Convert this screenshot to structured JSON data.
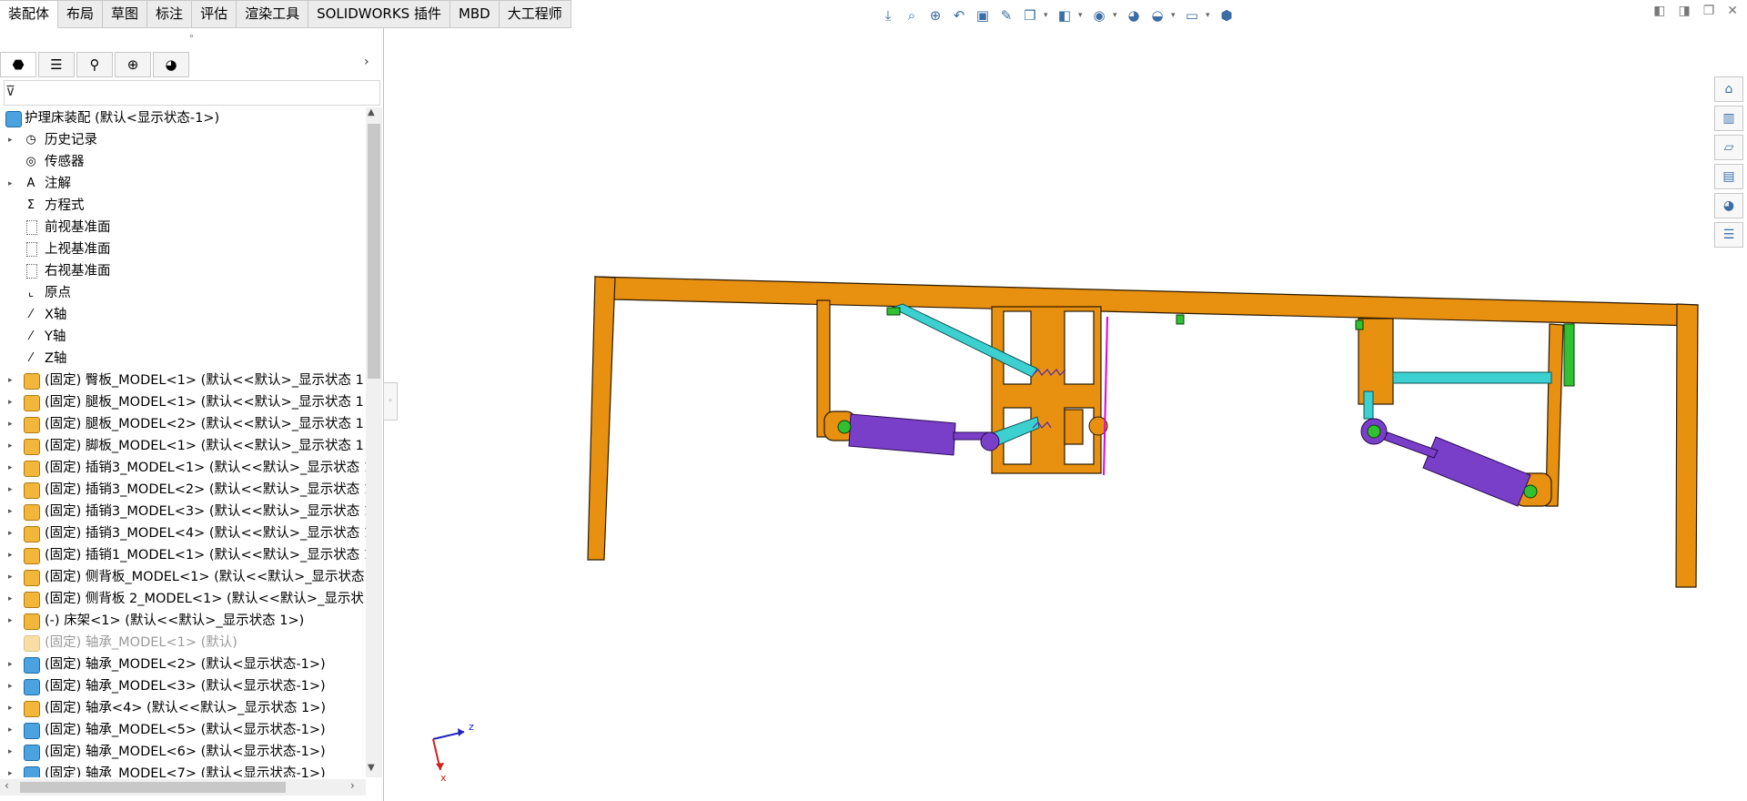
{
  "tabs": [
    {
      "label": "装配体",
      "active": true
    },
    {
      "label": "布局"
    },
    {
      "label": "草图"
    },
    {
      "label": "标注"
    },
    {
      "label": "评估"
    },
    {
      "label": "渲染工具"
    },
    {
      "label": "SOLIDWORKS 插件"
    },
    {
      "label": "MBD"
    },
    {
      "label": "大工程师"
    }
  ],
  "hud_icons": [
    "view-orient-icon",
    "zoom-fit-icon",
    "zoom-area-icon",
    "previous-view-icon",
    "section-view-icon",
    "dynamic-annotation-icon",
    "view-orientation-icon",
    "display-style-icon",
    "hide-show-icon",
    "edit-appearance-icon",
    "apply-scene-icon",
    "view-settings-icon",
    "3d-view-icon"
  ],
  "panel_tabs": [
    "featuremanager-icon",
    "propertymanager-icon",
    "configurationmanager-icon",
    "dimxpert-icon",
    "display-manager-icon"
  ],
  "tree": {
    "root": "护理床装配  (默认<显示状态-1>)",
    "items": [
      {
        "label": "历史记录",
        "icon": "history-icon",
        "expand": true
      },
      {
        "label": "传感器",
        "icon": "sensor-icon",
        "expand": false
      },
      {
        "label": "注解",
        "icon": "annotation-icon",
        "expand": true
      },
      {
        "label": "方程式",
        "icon": "equation-icon",
        "expand": false
      },
      {
        "label": "前视基准面",
        "icon": "plane-icon",
        "expand": false
      },
      {
        "label": "上视基准面",
        "icon": "plane-icon",
        "expand": false
      },
      {
        "label": "右视基准面",
        "icon": "plane-icon",
        "expand": false
      },
      {
        "label": "原点",
        "icon": "origin-icon",
        "expand": false
      },
      {
        "label": "X轴",
        "icon": "axis-icon",
        "expand": false
      },
      {
        "label": "Y轴",
        "icon": "axis-icon",
        "expand": false
      },
      {
        "label": "Z轴",
        "icon": "axis-icon",
        "expand": false
      },
      {
        "label": "(固定) 臀板_MODEL<1> (默认<<默认>_显示状态 1",
        "icon": "part-icon",
        "expand": true
      },
      {
        "label": "(固定) 腿板_MODEL<1> (默认<<默认>_显示状态 1",
        "icon": "part-icon",
        "expand": true
      },
      {
        "label": "(固定) 腿板_MODEL<2> (默认<<默认>_显示状态 1",
        "icon": "part-icon",
        "expand": true
      },
      {
        "label": "(固定) 脚板_MODEL<1> (默认<<默认>_显示状态 1",
        "icon": "part-icon",
        "expand": true
      },
      {
        "label": "(固定) 插销3_MODEL<1> (默认<<默认>_显示状态 1",
        "icon": "part-icon",
        "expand": true
      },
      {
        "label": "(固定) 插销3_MODEL<2> (默认<<默认>_显示状态 1",
        "icon": "part-icon",
        "expand": true
      },
      {
        "label": "(固定) 插销3_MODEL<3> (默认<<默认>_显示状态 1",
        "icon": "part-icon",
        "expand": true
      },
      {
        "label": "(固定) 插销3_MODEL<4> (默认<<默认>_显示状态 1",
        "icon": "part-icon",
        "expand": true
      },
      {
        "label": "(固定) 插销1_MODEL<1> (默认<<默认>_显示状态 1",
        "icon": "part-icon",
        "expand": true
      },
      {
        "label": "(固定) 侧背板_MODEL<1> (默认<<默认>_显示状态",
        "icon": "part-icon",
        "expand": true
      },
      {
        "label": "(固定) 侧背板 2_MODEL<1> (默认<<默认>_显示状",
        "icon": "part-icon",
        "expand": true
      },
      {
        "label": "(-) 床架<1> (默认<<默认>_显示状态 1>)",
        "icon": "part-icon",
        "expand": true
      },
      {
        "label": "(固定) 轴承_MODEL<1> (默认)",
        "icon": "part-icon",
        "expand": false,
        "dim": true
      },
      {
        "label": "(固定) 轴承_MODEL<2> (默认<显示状态-1>)",
        "icon": "part2-icon",
        "expand": true
      },
      {
        "label": "(固定) 轴承_MODEL<3> (默认<显示状态-1>)",
        "icon": "part2-icon",
        "expand": true
      },
      {
        "label": "(固定) 轴承<4> (默认<<默认>_显示状态 1>)",
        "icon": "part-icon",
        "expand": true
      },
      {
        "label": "(固定) 轴承_MODEL<5> (默认<显示状态-1>)",
        "icon": "part2-icon",
        "expand": true
      },
      {
        "label": "(固定) 轴承_MODEL<6> (默认<显示状态-1>)",
        "icon": "part2-icon",
        "expand": true
      },
      {
        "label": "(固定) 轴承_MODEL<7> (默认<显示状态-1>)",
        "icon": "part2-icon",
        "expand": true
      }
    ]
  },
  "task_pane": [
    "home-icon",
    "design-library-icon",
    "file-explorer-icon",
    "view-palette-icon",
    "appearances-icon",
    "custom-properties-icon"
  ],
  "triad": {
    "z": "z",
    "x": "x"
  },
  "colors": {
    "frame": "#E8900F",
    "linkage": "#3DD0D0",
    "cylinder": "#7A3FC8",
    "pin": "#30C030",
    "highlight": "#E000E0"
  }
}
